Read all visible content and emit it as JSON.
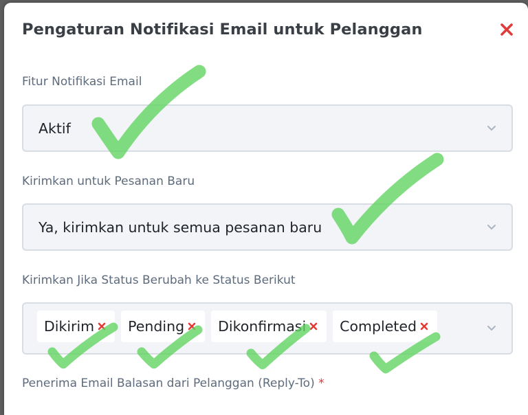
{
  "modal": {
    "title": "Pengaturan Notifikasi Email untuk Pelanggan"
  },
  "fields": {
    "email_feature": {
      "label": "Fitur Notifikasi Email",
      "value": "Aktif"
    },
    "new_orders": {
      "label": "Kirimkan untuk Pesanan Baru",
      "value": "Ya, kirimkan untuk semua pesanan baru"
    },
    "status_change": {
      "label": "Kirimkan Jika Status Berubah ke Status Berikut",
      "tags": [
        "Dikirim",
        "Pending",
        "Dikonfirmasi",
        "Completed"
      ]
    },
    "reply_to": {
      "label": "Penerima Email Balasan dari Pelanggan (Reply-To)",
      "required_marker": "*"
    }
  },
  "icons": {
    "close": "close-icon",
    "chevron": "chevron-down-icon",
    "tag_remove": "close-icon",
    "annotation": "checkmark-icon"
  },
  "colors": {
    "close": "#e03a3a",
    "tag_remove": "#e53935",
    "required": "#e03a3a",
    "checkmark": "#5fd35f"
  }
}
